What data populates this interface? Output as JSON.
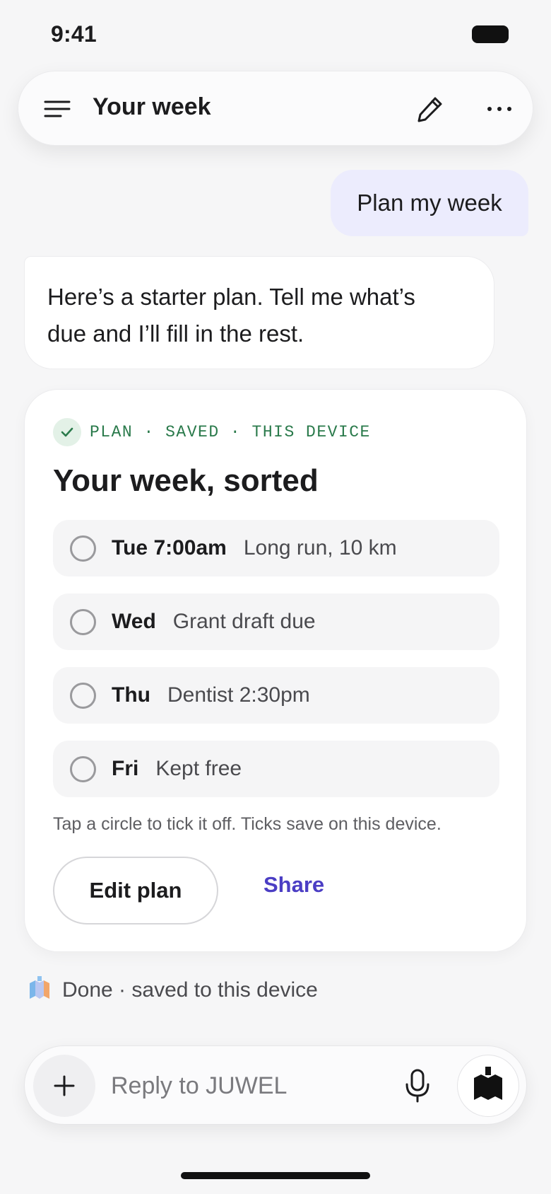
{
  "status_bar": {
    "time": "9:41"
  },
  "header": {
    "title": "Your week",
    "icons": [
      "menu-icon",
      "pencil-icon",
      "more-icon"
    ]
  },
  "messages": {
    "user": "Plan my week",
    "assistant_line1": "Here’s a starter plan. Tell me what’s",
    "assistant_line2": "due and I’ll fill in the rest."
  },
  "plan": {
    "status": "PLAN · SAVED · THIS DEVICE",
    "title": "Your week, sorted",
    "tasks": [
      {
        "day": "Tue 7:00am",
        "desc": "Long run, 10 km",
        "done": false
      },
      {
        "day": "Wed",
        "desc": "Grant draft due",
        "done": false
      },
      {
        "day": "Thu",
        "desc": "Dentist 2:30pm",
        "done": false
      },
      {
        "day": "Fri",
        "desc": "Kept free",
        "done": false
      }
    ],
    "hint": "Tap a circle to tick it off. Ticks save on this device.",
    "edit_label": "Edit plan",
    "share_label": "Share"
  },
  "done_line": "Done · saved to this device",
  "composer": {
    "placeholder": "Reply to JUWEL"
  },
  "colors": {
    "accent": "#4b3ec4",
    "user_bubble": "#ececfd",
    "status_green": "#2a7a4b",
    "background": "#f6f6f7"
  }
}
